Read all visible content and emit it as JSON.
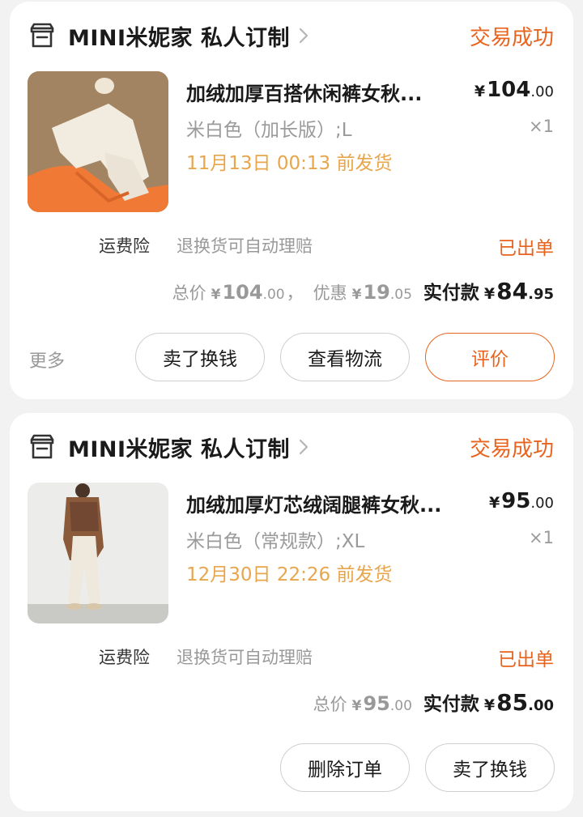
{
  "orders": [
    {
      "shop_name": "MINI米妮家 私人订制",
      "status": "交易成功",
      "product_title": "加绒加厚百搭休闲裤女秋...",
      "price_symbol": "¥",
      "price_int": "104",
      "price_dec": ".00",
      "variant": "米白色（加长版）;L",
      "quantity": "×1",
      "ship_by": "11月13日 00:13 前发货",
      "insurance_label": "运费险",
      "insurance_desc": "退换货可自动理赔",
      "dispatch_status": "已出单",
      "total_label": "总价",
      "total_int": "104",
      "total_dec": ".00",
      "separator": "，",
      "discount_label": "优惠",
      "discount_int": "19",
      "discount_dec": ".05",
      "paid_label": "实付款",
      "paid_int": "84",
      "paid_dec": ".95",
      "more_label": "更多",
      "buttons": [
        "卖了换钱",
        "查看物流",
        "评价"
      ]
    },
    {
      "shop_name": "MINI米妮家 私人订制",
      "status": "交易成功",
      "product_title": "加绒加厚灯芯绒阔腿裤女秋...",
      "price_symbol": "¥",
      "price_int": "95",
      "price_dec": ".00",
      "variant": "米白色（常规款）;XL",
      "quantity": "×1",
      "ship_by": "12月30日 22:26 前发货",
      "insurance_label": "运费险",
      "insurance_desc": "退换货可自动理赔",
      "dispatch_status": "已出单",
      "total_label": "总价",
      "total_int": "95",
      "total_dec": ".00",
      "paid_label": "实付款",
      "paid_int": "85",
      "paid_dec": ".00",
      "buttons": [
        "删除订单",
        "卖了换钱"
      ]
    }
  ],
  "colors": {
    "accent": "#e8641e",
    "ship_date": "#e8a64c",
    "muted": "#999999",
    "background": "#f2f2f2"
  },
  "icons": [
    "store-icon",
    "chevron-right-icon"
  ]
}
